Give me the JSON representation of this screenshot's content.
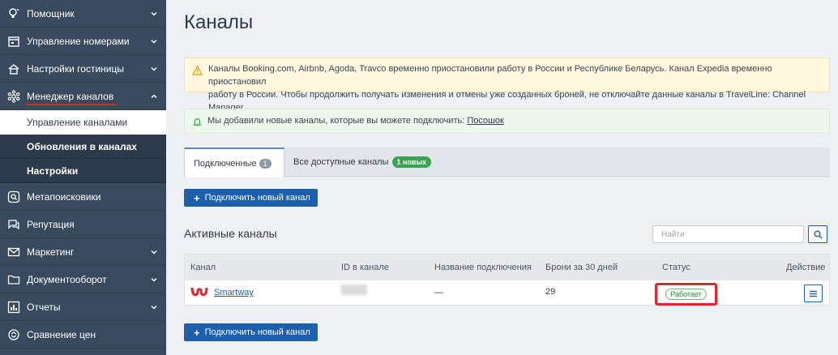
{
  "sidebar": {
    "items": [
      {
        "label": "Помощник",
        "icon": "lightbulb-icon"
      },
      {
        "label": "Управление номерами",
        "icon": "calendar-icon"
      },
      {
        "label": "Настройки гостиницы",
        "icon": "house-icon"
      },
      {
        "label": "Менеджер каналов",
        "icon": "network-icon"
      },
      {
        "label": "Метапоисковики",
        "icon": "meta-search-icon"
      },
      {
        "label": "Репутация",
        "icon": "chat-icon"
      },
      {
        "label": "Маркетинг",
        "icon": "envelope-icon"
      },
      {
        "label": "Документооборот",
        "icon": "folder-icon"
      },
      {
        "label": "Отчеты",
        "icon": "bar-chart-icon"
      },
      {
        "label": "Сравнение цен",
        "icon": "price-compare-icon"
      }
    ],
    "subitems": [
      {
        "label": "Управление каналами"
      },
      {
        "label": "Обновления в каналах"
      },
      {
        "label": "Настройки"
      }
    ],
    "active_underline_color": "#e0252b"
  },
  "main": {
    "title": "Каналы",
    "warning": {
      "line1": "Каналы Booking.com, Airbnb, Agoda, Travco временно приостановили работу в России и Республике Беларусь. Канал Expedia временно приостановил",
      "line2": "работу в России. Чтобы продолжить получать изменения и отмены уже созданных броней, не отключайте данные каналы в TravelLine: Channel Manager."
    },
    "info": {
      "text": "Мы добавили новые каналы, которые вы можете подключить: ",
      "link": "Посошок"
    },
    "tabs": [
      {
        "label": "Подключенные",
        "badge": "1"
      },
      {
        "label": "Все доступные каналы",
        "badge": "1 новых"
      }
    ],
    "connect_button": "Подключить новый канал",
    "section_title": "Активные каналы",
    "search": {
      "placeholder": "Найти"
    },
    "table": {
      "headers": [
        "Канал",
        "ID в канале",
        "Название подключения",
        "Брони за 30 дней",
        "Статус",
        "Действие"
      ],
      "rows": [
        {
          "channel": "Smartway",
          "connection_name": "—",
          "bookings": "29",
          "status": "Работает"
        }
      ]
    }
  },
  "colors": {
    "sidebar_bg": "#3a4a5e",
    "primary": "#1b5fae",
    "highlight": "#e0252b",
    "success": "#39a553"
  }
}
